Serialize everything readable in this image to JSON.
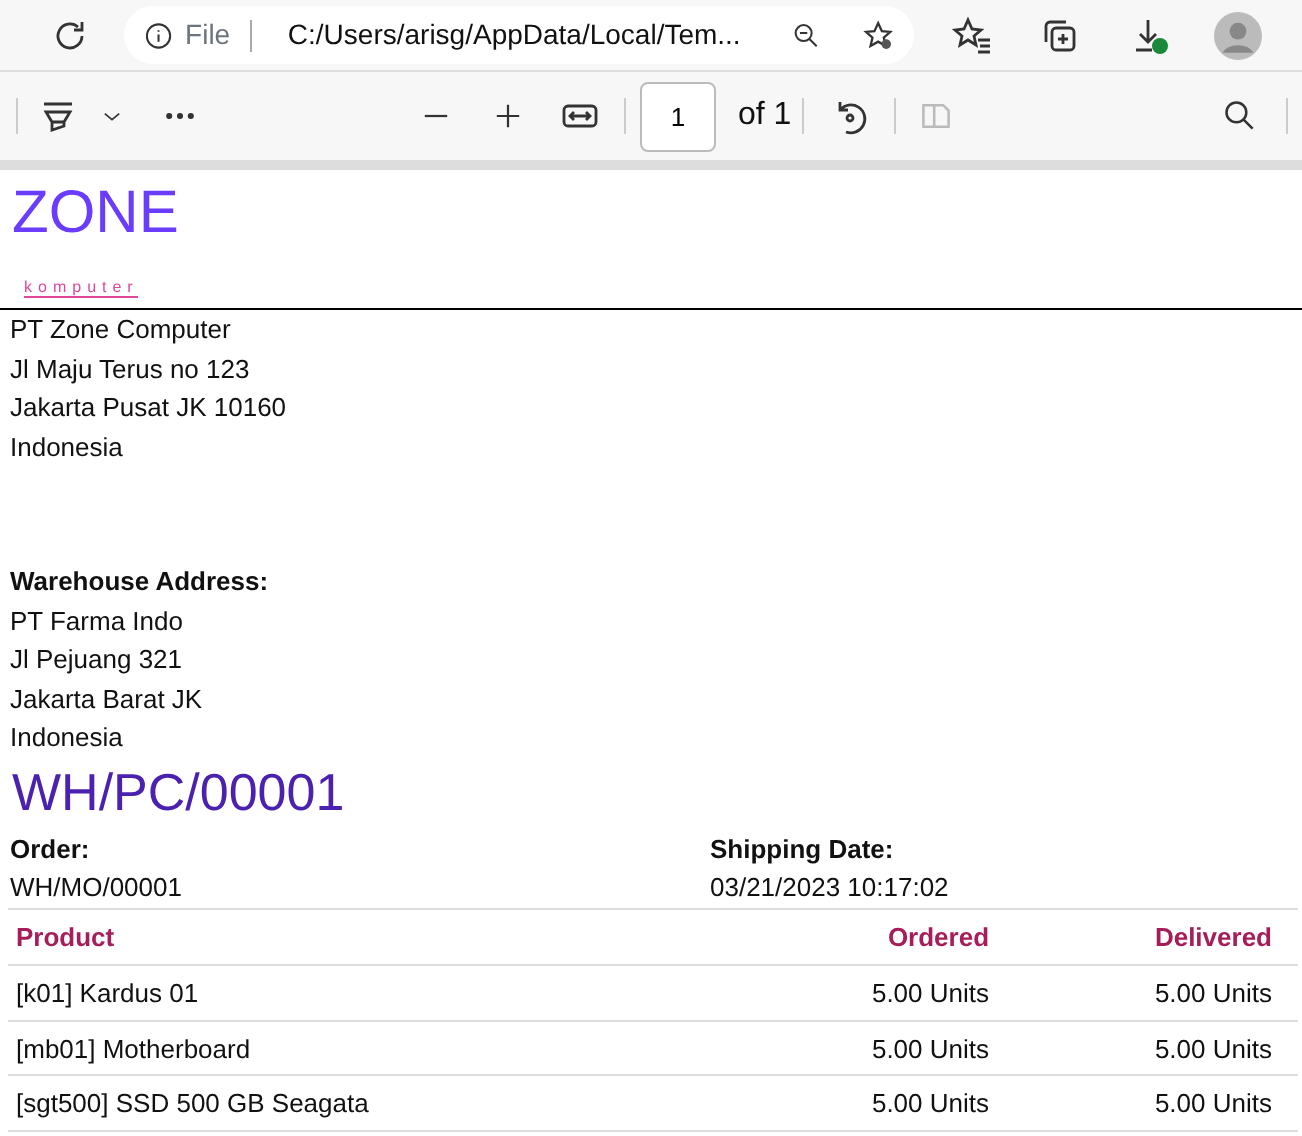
{
  "browser": {
    "site_label": "File",
    "address": "C:/Users/arisg/AppData/Local/Tem..."
  },
  "pdf_toolbar": {
    "page": "1",
    "page_count": "of 1"
  },
  "logo": {
    "name": "ZONE",
    "tagline": "komputer"
  },
  "company_address": [
    "PT Zone Computer",
    "Jl Maju Terus no 123",
    "Jakarta Pusat JK 10160",
    "Indonesia"
  ],
  "warehouse": {
    "heading": "Warehouse Address:",
    "lines": [
      "PT Farma Indo",
      "Jl Pejuang 321",
      "Jakarta Barat JK",
      "Indonesia"
    ]
  },
  "document_title": "WH/PC/00001",
  "info": [
    {
      "label": "Order:",
      "value": "WH/MO/00001"
    },
    {
      "label": "Shipping Date:",
      "value": "03/21/2023 10:17:02"
    }
  ],
  "table": {
    "columns": [
      "Product",
      "Ordered",
      "Delivered"
    ],
    "rows": [
      [
        "[k01] Kardus 01",
        "5.00 Units",
        "5.00 Units"
      ],
      [
        "[mb01] Motherboard",
        "5.00 Units",
        "5.00 Units"
      ],
      [
        "[sgt500] SSD 500 GB Seagata",
        "5.00 Units",
        "5.00 Units"
      ]
    ]
  }
}
